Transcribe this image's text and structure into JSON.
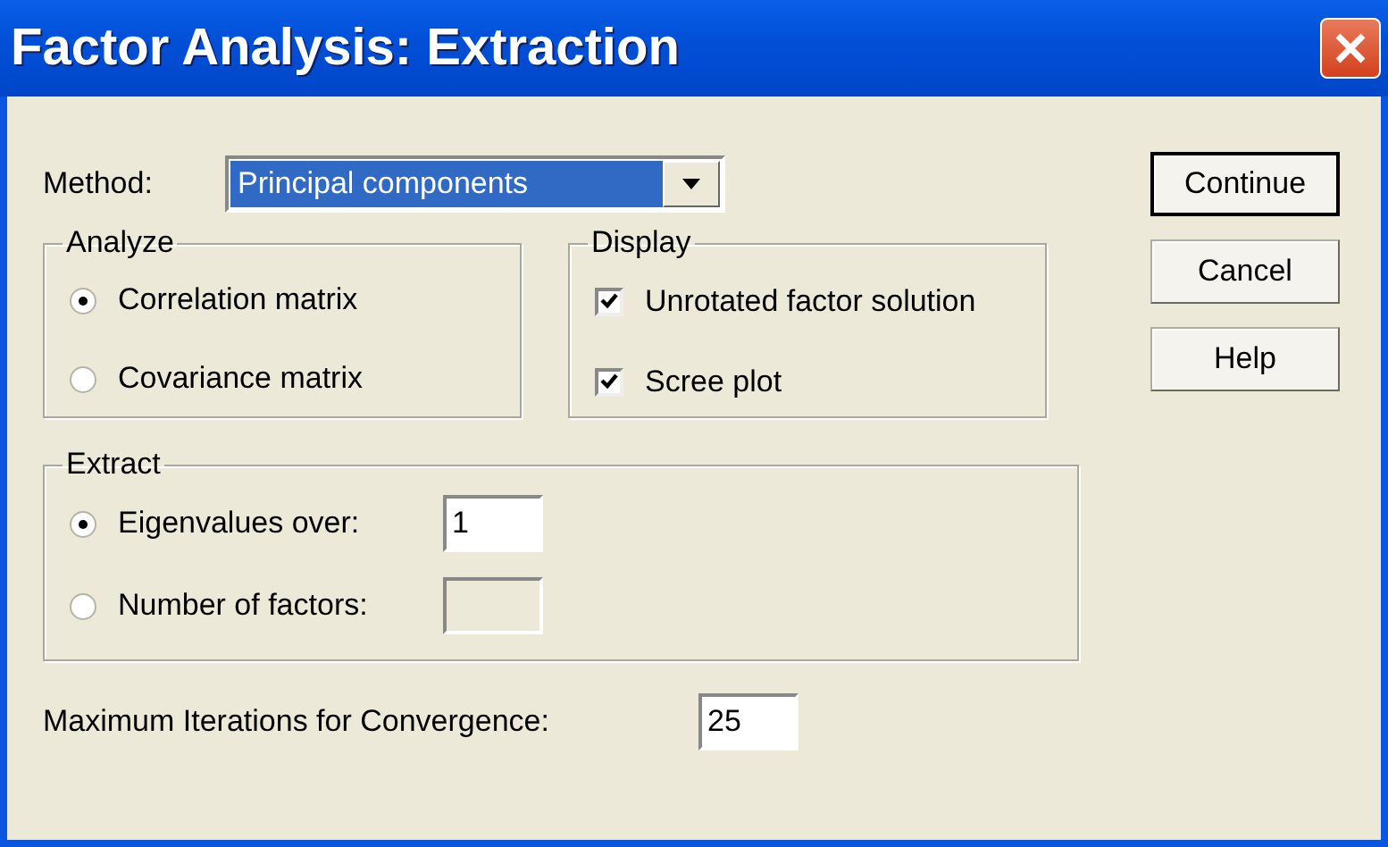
{
  "window": {
    "title": "Factor Analysis: Extraction"
  },
  "method": {
    "label": "Method:",
    "value": "Principal components"
  },
  "analyze": {
    "title": "Analyze",
    "options": [
      {
        "label": "Correlation matrix",
        "selected": true
      },
      {
        "label": "Covariance matrix",
        "selected": false
      }
    ]
  },
  "display": {
    "title": "Display",
    "options": [
      {
        "label": "Unrotated factor solution",
        "checked": true
      },
      {
        "label": "Scree plot",
        "checked": true
      }
    ]
  },
  "extract": {
    "title": "Extract",
    "options": [
      {
        "label": "Eigenvalues over:",
        "selected": true,
        "disabled": false,
        "value": "1"
      },
      {
        "label": "Number of factors:",
        "selected": false,
        "disabled": true
      }
    ]
  },
  "max_iterations": {
    "label": "Maximum Iterations for Convergence:",
    "value": "25"
  },
  "buttons": [
    {
      "label": "Continue",
      "default": true
    },
    {
      "label": "Cancel",
      "default": false
    },
    {
      "label": "Help",
      "default": false
    }
  ]
}
